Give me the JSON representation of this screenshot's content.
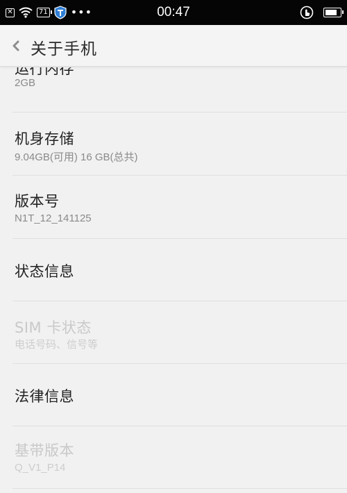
{
  "status_bar": {
    "battery_small": "71",
    "more": "•••",
    "time": "00:47"
  },
  "header": {
    "title": "关于手机"
  },
  "items": [
    {
      "title": "运行内存",
      "subtitle": "2GB",
      "enabled": true
    },
    {
      "title": "机身存储",
      "subtitle": "9.04GB(可用)   16 GB(总共)",
      "enabled": true
    },
    {
      "title": "版本号",
      "subtitle": "N1T_12_141125",
      "enabled": true
    },
    {
      "title": "状态信息",
      "subtitle": "",
      "enabled": true
    },
    {
      "title": "SIM 卡状态",
      "subtitle": "电话号码、信号等",
      "enabled": false
    },
    {
      "title": "法律信息",
      "subtitle": "",
      "enabled": true
    },
    {
      "title": "基带版本",
      "subtitle": "Q_V1_P14",
      "enabled": false
    }
  ]
}
